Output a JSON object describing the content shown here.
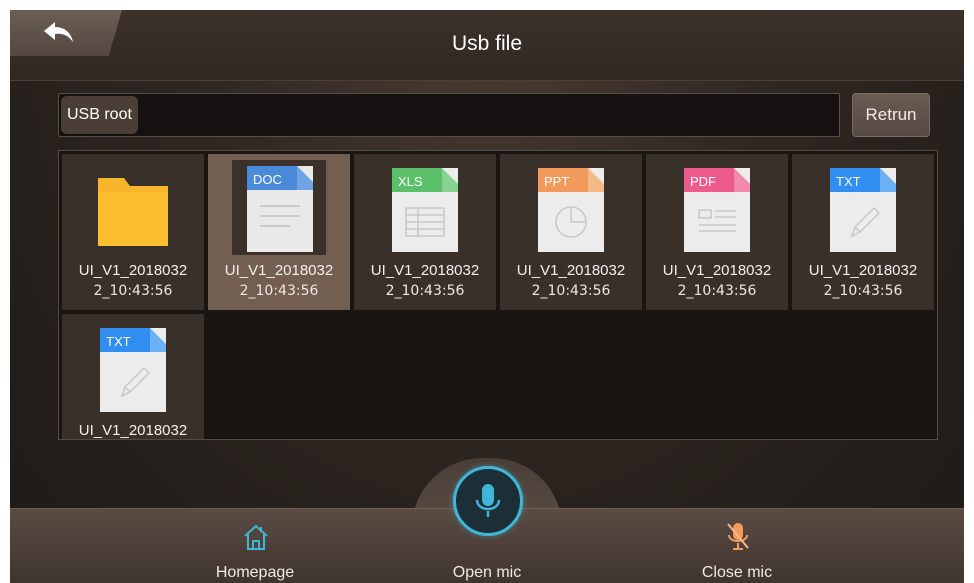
{
  "header": {
    "title": "Usb file",
    "back_icon": "back-arrow-icon"
  },
  "pathbar": {
    "path": "USB root",
    "return_label": "Retrun"
  },
  "files": [
    {
      "type": "folder",
      "badge": "",
      "name": "UI_V1_2018032",
      "time": "2_10:43:56",
      "selected": false
    },
    {
      "type": "doc",
      "badge": "DOC",
      "name": "UI_V1_2018032",
      "time": "2_10:43:56",
      "selected": true
    },
    {
      "type": "xls",
      "badge": "XLS",
      "name": "UI_V1_2018032",
      "time": "2_10:43:56",
      "selected": false
    },
    {
      "type": "ppt",
      "badge": "PPT",
      "name": "UI_V1_2018032",
      "time": "2_10:43:56",
      "selected": false
    },
    {
      "type": "pdf",
      "badge": "PDF",
      "name": "UI_V1_2018032",
      "time": "2_10:43:56",
      "selected": false
    },
    {
      "type": "txt",
      "badge": "TXT",
      "name": "UI_V1_2018032",
      "time": "2_10:43:56",
      "selected": false
    },
    {
      "type": "txt",
      "badge": "TXT",
      "name": "UI_V1_2018032",
      "time": "",
      "selected": false
    }
  ],
  "bottom_nav": {
    "homepage": "Homepage",
    "open_mic": "Open mic",
    "close_mic": "Close mic"
  },
  "colors": {
    "accent": "#3fb6d8",
    "doc": "#4a8ad8",
    "xls": "#5cc06a",
    "ppt": "#f19a5c",
    "pdf": "#ec5b8c",
    "txt": "#2f8ef0",
    "folder": "#f6b42a"
  }
}
